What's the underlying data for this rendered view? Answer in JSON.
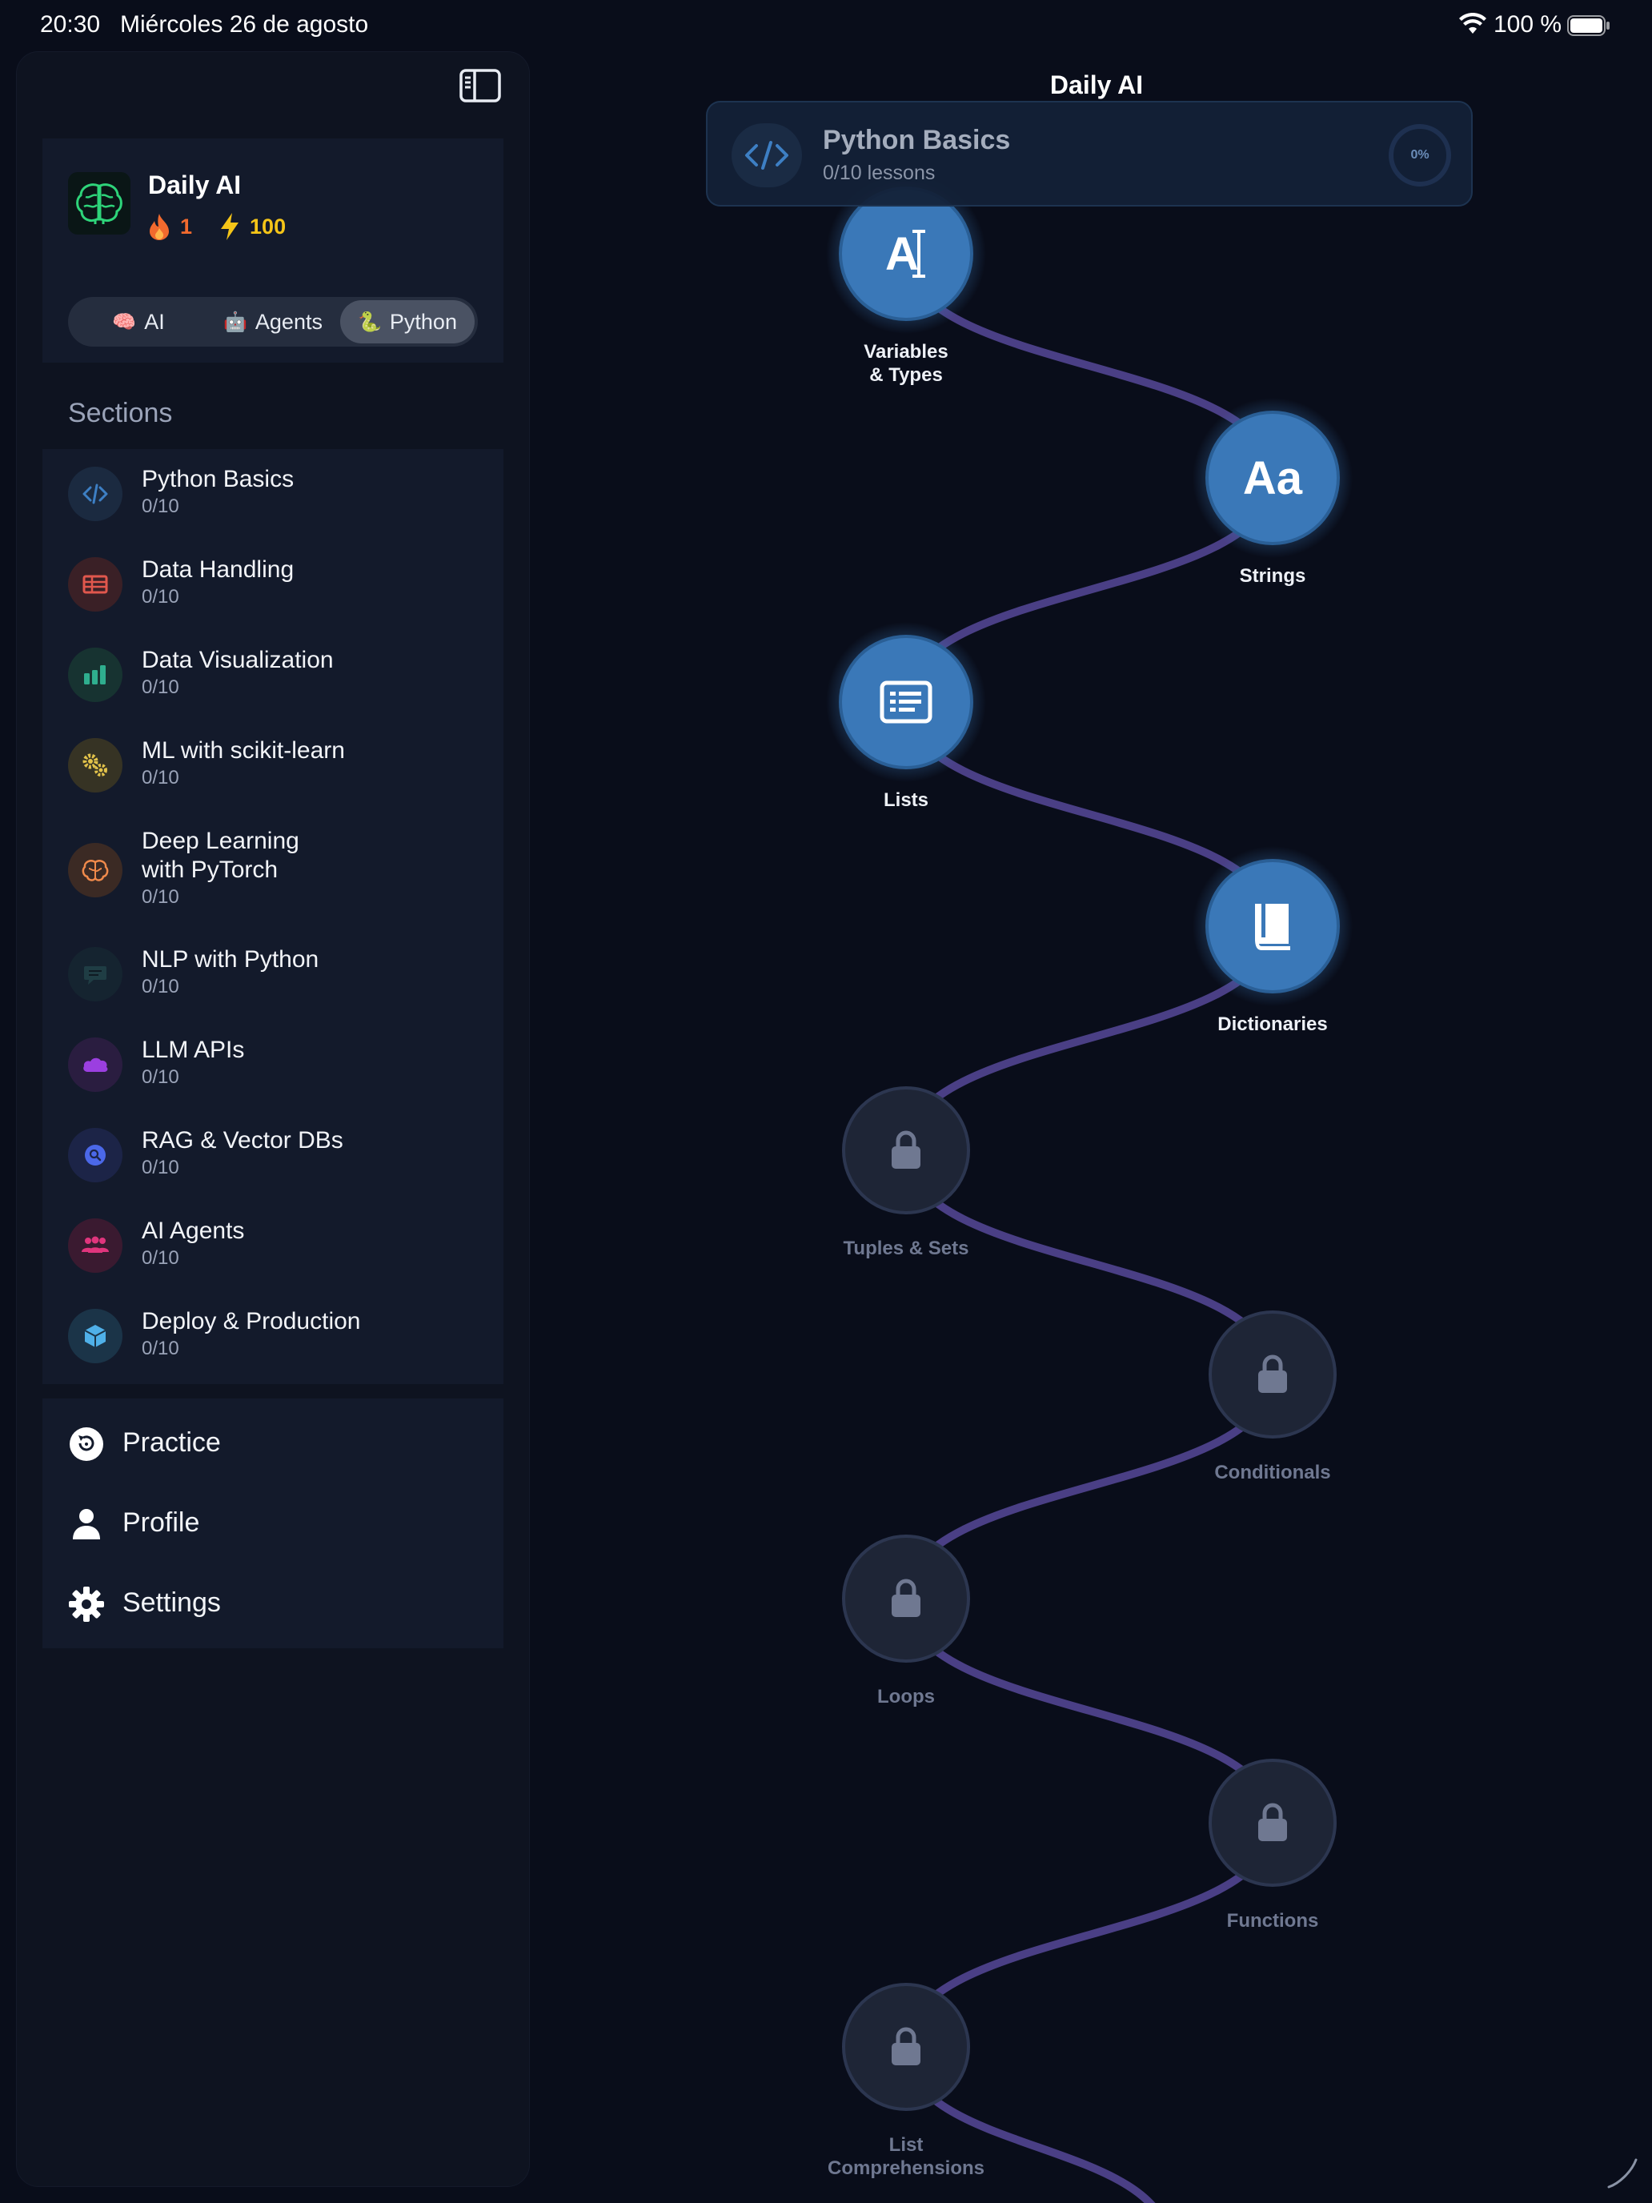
{
  "status_bar": {
    "time": "20:30",
    "date": "Miércoles 26 de agosto",
    "battery": "100 %",
    "wifi_icon": "wifi-icon",
    "battery_icon": "battery-icon"
  },
  "sidebar": {
    "toggle_icon": "sidebar-toggle-icon",
    "app": {
      "name": "Daily AI",
      "logo_icon": "brain-icon",
      "streak": "1",
      "streak_icon": "flame-icon",
      "xp": "100",
      "xp_icon": "bolt-icon"
    },
    "tracks": [
      {
        "emoji": "🧠",
        "label": "AI",
        "active": false
      },
      {
        "emoji": "🤖",
        "label": "Agents",
        "active": false
      },
      {
        "emoji": "🐍",
        "label": "Python",
        "active": true
      }
    ],
    "sections_header": "Sections",
    "sections": [
      {
        "title": "Python Basics",
        "progress": "0/10",
        "icon": "code-icon",
        "color": "#3d7fc4",
        "bg": "#1b2a40"
      },
      {
        "title": "Data Handling",
        "progress": "0/10",
        "icon": "table-icon",
        "color": "#e0574d",
        "bg": "#3a2026"
      },
      {
        "title": "Data Visualization",
        "progress": "0/10",
        "icon": "bar-chart-icon",
        "color": "#2fae8e",
        "bg": "#173331"
      },
      {
        "title": "ML with scikit-learn",
        "progress": "0/10",
        "icon": "gears-icon",
        "color": "#e2c24a",
        "bg": "#363324"
      },
      {
        "title": "Deep Learning\nwith PyTorch",
        "progress": "0/10",
        "icon": "brain-outline-icon",
        "color": "#f08a4b",
        "bg": "#3b2a24"
      },
      {
        "title": "NLP with Python",
        "progress": "0/10",
        "icon": "chat-icon",
        "color": "#1f3d44",
        "bg": "#152430"
      },
      {
        "title": "LLM APIs",
        "progress": "0/10",
        "icon": "cloud-icon",
        "color": "#9b3fe0",
        "bg": "#2a1d40"
      },
      {
        "title": "RAG & Vector DBs",
        "progress": "0/10",
        "icon": "search-circle-icon",
        "color": "#4b68e8",
        "bg": "#1c2447"
      },
      {
        "title": "AI Agents",
        "progress": "0/10",
        "icon": "people-icon",
        "color": "#e0357d",
        "bg": "#3a1a30"
      },
      {
        "title": "Deploy & Production",
        "progress": "0/10",
        "icon": "cube-icon",
        "color": "#4fb0e8",
        "bg": "#1b3448"
      }
    ],
    "nav": [
      {
        "label": "Practice",
        "icon": "practice-icon"
      },
      {
        "label": "Profile",
        "icon": "profile-icon"
      },
      {
        "label": "Settings",
        "icon": "gear-icon"
      }
    ]
  },
  "main": {
    "title": "Daily AI",
    "section_card": {
      "title": "Python Basics",
      "subtitle": "0/10 lessons",
      "progress": "0%",
      "progress_fraction": 0,
      "icon": "code-icon"
    },
    "lessons": [
      {
        "label": "Variables\n& Types",
        "state": "unlocked",
        "icon": "text-cursor-icon"
      },
      {
        "label": "Strings",
        "state": "unlocked",
        "icon": "text-aa-icon"
      },
      {
        "label": "Lists",
        "state": "unlocked",
        "icon": "list-icon"
      },
      {
        "label": "Dictionaries",
        "state": "unlocked",
        "icon": "book-icon"
      },
      {
        "label": "Tuples & Sets",
        "state": "locked",
        "icon": "lock-icon"
      },
      {
        "label": "Conditionals",
        "state": "locked",
        "icon": "lock-icon"
      },
      {
        "label": "Loops",
        "state": "locked",
        "icon": "lock-icon"
      },
      {
        "label": "Functions",
        "state": "locked",
        "icon": "lock-icon"
      },
      {
        "label": "List\nComprehensions",
        "state": "locked",
        "icon": "lock-icon"
      }
    ],
    "colors": {
      "path": "#4a3f85",
      "unlocked_node": "#3a78b8",
      "locked_node": "#1e2536"
    }
  }
}
